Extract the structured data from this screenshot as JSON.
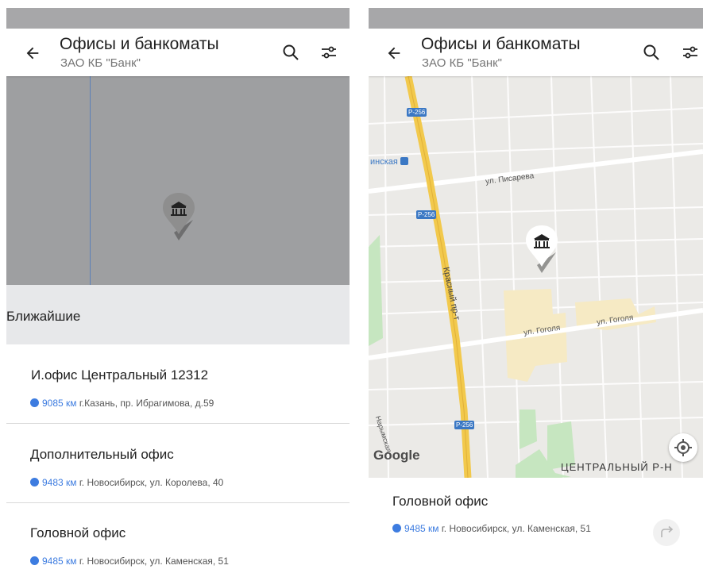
{
  "left_screen": {
    "appbar": {
      "title": "Офисы и банкоматы",
      "subtitle": "ЗАО КБ \"Банк\""
    },
    "section_header": "Ближайшие",
    "items": [
      {
        "name": "И.офис Центральный 12312",
        "distance": "9085 км",
        "address": "г.Казань, пр. Ибрагимова, д.59"
      },
      {
        "name": "Дополнительный офис",
        "distance": "9483 км",
        "address": "г. Новосибирск, ул. Королева, 40"
      },
      {
        "name": "Головной офис",
        "distance": "9485 км",
        "address": "г. Новосибирск, ул. Каменская, 51"
      }
    ]
  },
  "right_screen": {
    "appbar": {
      "title": "Офисы и банкоматы",
      "subtitle": "ЗАО КБ \"Банк\""
    },
    "map": {
      "road_shields": [
        "Р-256",
        "Р-256",
        "Р-256"
      ],
      "street_labels": {
        "metro": "инская",
        "pisareva": "ул. Писарева",
        "krasny": "Красный пр-т",
        "gogolya_1": "ул. Гоголя",
        "gogolya_2": "ул. Гоголя",
        "district": "ЦЕНТРАЛЬНЫЙ Р-Н",
        "edge": "Нарымская"
      },
      "google_logo": "Google"
    },
    "selected": {
      "name": "Головной офис",
      "distance": "9485 км",
      "address": "г. Новосибирск, ул. Каменская, 51"
    }
  },
  "colors": {
    "accent": "#3d7ce0",
    "status_bar": "#a7a7a9",
    "map_overlay": "#9e9fa1",
    "section_bg": "#e7e8ea",
    "highway": "#f2c94c"
  },
  "icons": [
    "back-arrow-icon",
    "search-icon",
    "filter-icon",
    "bank-icon",
    "location-pin-icon",
    "my-location-icon",
    "route-icon"
  ]
}
